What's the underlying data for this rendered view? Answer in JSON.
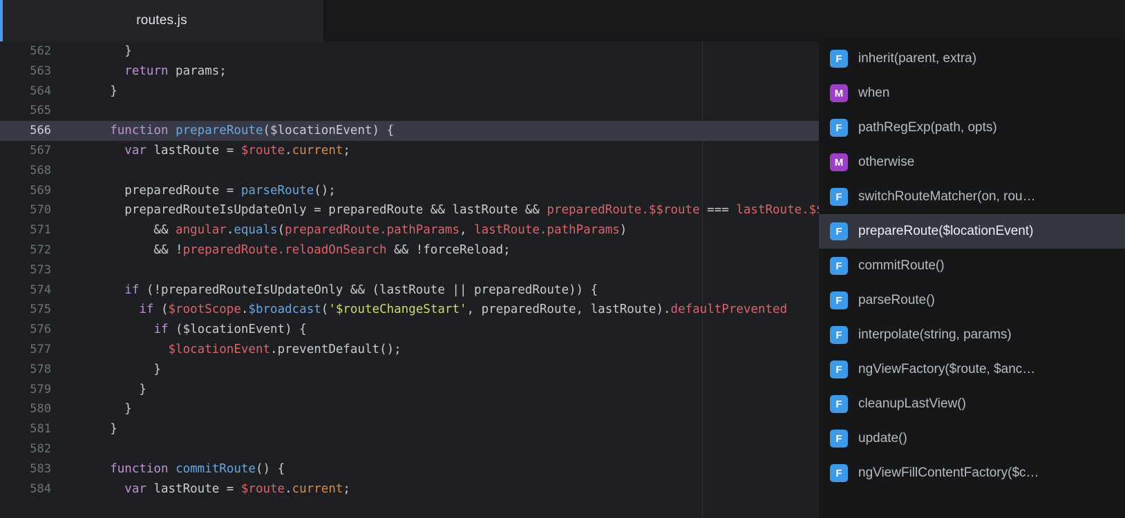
{
  "window": {
    "accent_color": "#4d9bf0",
    "editor_bg": "#1e1f22",
    "popup_bg": "#161719",
    "active_line_bg": "#383b47",
    "selected_item_bg": "#34373f"
  },
  "tab": {
    "label": "routes.js"
  },
  "editor": {
    "first_line_number": 562,
    "active_line_number": 566,
    "lines": [
      {
        "n": "562",
        "tokens": [
          {
            "t": "        }",
            "c": "pl"
          }
        ]
      },
      {
        "n": "563",
        "tokens": [
          {
            "t": "        ",
            "c": "pl"
          },
          {
            "t": "return",
            "c": "kw"
          },
          {
            "t": " params;",
            "c": "pl"
          }
        ]
      },
      {
        "n": "564",
        "tokens": [
          {
            "t": "      }",
            "c": "pl"
          }
        ]
      },
      {
        "n": "565",
        "tokens": [
          {
            "t": "",
            "c": "pl"
          }
        ]
      },
      {
        "n": "566",
        "active": true,
        "tokens": [
          {
            "t": "      ",
            "c": "pl"
          },
          {
            "t": "function",
            "c": "kw"
          },
          {
            "t": " ",
            "c": "pl"
          },
          {
            "t": "prepareRoute",
            "c": "fn"
          },
          {
            "t": "($locationEvent) {",
            "c": "pl"
          }
        ]
      },
      {
        "n": "567",
        "tokens": [
          {
            "t": "        ",
            "c": "pl"
          },
          {
            "t": "var",
            "c": "kw"
          },
          {
            "t": " lastRoute = ",
            "c": "pl"
          },
          {
            "t": "$route",
            "c": "id"
          },
          {
            "t": ".",
            "c": "pl"
          },
          {
            "t": "current",
            "c": "prop"
          },
          {
            "t": ";",
            "c": "pl"
          }
        ]
      },
      {
        "n": "568",
        "tokens": [
          {
            "t": "",
            "c": "pl"
          }
        ]
      },
      {
        "n": "569",
        "tokens": [
          {
            "t": "        preparedRoute = ",
            "c": "pl"
          },
          {
            "t": "parseRoute",
            "c": "fn"
          },
          {
            "t": "();",
            "c": "pl"
          }
        ]
      },
      {
        "n": "570",
        "tokens": [
          {
            "t": "        preparedRouteIsUpdateOnly = preparedRoute && lastRoute && ",
            "c": "pl"
          },
          {
            "t": "preparedRoute.$$route",
            "c": "id"
          },
          {
            "t": " === ",
            "c": "pl"
          },
          {
            "t": "lastRoute.$$route",
            "c": "id"
          }
        ]
      },
      {
        "n": "571",
        "tokens": [
          {
            "t": "            && ",
            "c": "pl"
          },
          {
            "t": "angular",
            "c": "id"
          },
          {
            "t": ".",
            "c": "pl"
          },
          {
            "t": "equals",
            "c": "fn"
          },
          {
            "t": "(",
            "c": "pl"
          },
          {
            "t": "preparedRoute.pathParams",
            "c": "id"
          },
          {
            "t": ", ",
            "c": "pl"
          },
          {
            "t": "lastRoute.pathParams",
            "c": "id"
          },
          {
            "t": ")",
            "c": "pl"
          }
        ]
      },
      {
        "n": "572",
        "tokens": [
          {
            "t": "            && !",
            "c": "pl"
          },
          {
            "t": "preparedRoute.reloadOnSearch",
            "c": "id"
          },
          {
            "t": " && !forceReload;",
            "c": "pl"
          }
        ]
      },
      {
        "n": "573",
        "tokens": [
          {
            "t": "",
            "c": "pl"
          }
        ]
      },
      {
        "n": "574",
        "tokens": [
          {
            "t": "        ",
            "c": "pl"
          },
          {
            "t": "if",
            "c": "kw"
          },
          {
            "t": " (!preparedRouteIsUpdateOnly && (lastRoute || preparedRoute)) {",
            "c": "pl"
          }
        ]
      },
      {
        "n": "575",
        "tokens": [
          {
            "t": "          ",
            "c": "pl"
          },
          {
            "t": "if",
            "c": "kw"
          },
          {
            "t": " (",
            "c": "pl"
          },
          {
            "t": "$rootScope",
            "c": "id"
          },
          {
            "t": ".",
            "c": "pl"
          },
          {
            "t": "$broadcast",
            "c": "fn"
          },
          {
            "t": "(",
            "c": "pl"
          },
          {
            "t": "'$routeChangeStart'",
            "c": "str"
          },
          {
            "t": ", preparedRoute, lastRoute).",
            "c": "pl"
          },
          {
            "t": "defaultPrevented",
            "c": "id"
          }
        ]
      },
      {
        "n": "576",
        "tokens": [
          {
            "t": "            ",
            "c": "pl"
          },
          {
            "t": "if",
            "c": "kw"
          },
          {
            "t": " ($locationEvent) {",
            "c": "pl"
          }
        ]
      },
      {
        "n": "577",
        "tokens": [
          {
            "t": "              ",
            "c": "pl"
          },
          {
            "t": "$locationEvent",
            "c": "id"
          },
          {
            "t": ".",
            "c": "pl"
          },
          {
            "t": "preventDefault",
            "c": "pl"
          },
          {
            "t": "();",
            "c": "pl"
          }
        ]
      },
      {
        "n": "578",
        "tokens": [
          {
            "t": "            }",
            "c": "pl"
          }
        ]
      },
      {
        "n": "579",
        "tokens": [
          {
            "t": "          }",
            "c": "pl"
          }
        ]
      },
      {
        "n": "580",
        "tokens": [
          {
            "t": "        }",
            "c": "pl"
          }
        ]
      },
      {
        "n": "581",
        "tokens": [
          {
            "t": "      }",
            "c": "pl"
          }
        ]
      },
      {
        "n": "582",
        "tokens": [
          {
            "t": "",
            "c": "pl"
          }
        ]
      },
      {
        "n": "583",
        "tokens": [
          {
            "t": "      ",
            "c": "pl"
          },
          {
            "t": "function",
            "c": "kw"
          },
          {
            "t": " ",
            "c": "pl"
          },
          {
            "t": "commitRoute",
            "c": "fn"
          },
          {
            "t": "() {",
            "c": "pl"
          }
        ]
      },
      {
        "n": "584",
        "tokens": [
          {
            "t": "        ",
            "c": "pl"
          },
          {
            "t": "var",
            "c": "kw"
          },
          {
            "t": " lastRoute = ",
            "c": "pl"
          },
          {
            "t": "$route",
            "c": "id"
          },
          {
            "t": ".",
            "c": "pl"
          },
          {
            "t": "current",
            "c": "prop"
          },
          {
            "t": ";",
            "c": "pl"
          }
        ]
      }
    ]
  },
  "autocomplete": {
    "selected_index": 5,
    "items": [
      {
        "icon": "function-icon",
        "kind": "F",
        "label": "inherit(parent, extra)"
      },
      {
        "icon": "method-icon",
        "kind": "M",
        "label": "when"
      },
      {
        "icon": "function-icon",
        "kind": "F",
        "label": "pathRegExp(path, opts)"
      },
      {
        "icon": "method-icon",
        "kind": "M",
        "label": "otherwise"
      },
      {
        "icon": "function-icon",
        "kind": "F",
        "label": "switchRouteMatcher(on, rou…"
      },
      {
        "icon": "function-icon",
        "kind": "F",
        "label": "prepareRoute($locationEvent)"
      },
      {
        "icon": "function-icon",
        "kind": "F",
        "label": "commitRoute()"
      },
      {
        "icon": "function-icon",
        "kind": "F",
        "label": "parseRoute()"
      },
      {
        "icon": "function-icon",
        "kind": "F",
        "label": "interpolate(string, params)"
      },
      {
        "icon": "function-icon",
        "kind": "F",
        "label": "ngViewFactory($route, $anc…"
      },
      {
        "icon": "function-icon",
        "kind": "F",
        "label": "cleanupLastView()"
      },
      {
        "icon": "function-icon",
        "kind": "F",
        "label": "update()"
      },
      {
        "icon": "function-icon",
        "kind": "F",
        "label": "ngViewFillContentFactory($c…"
      }
    ]
  }
}
